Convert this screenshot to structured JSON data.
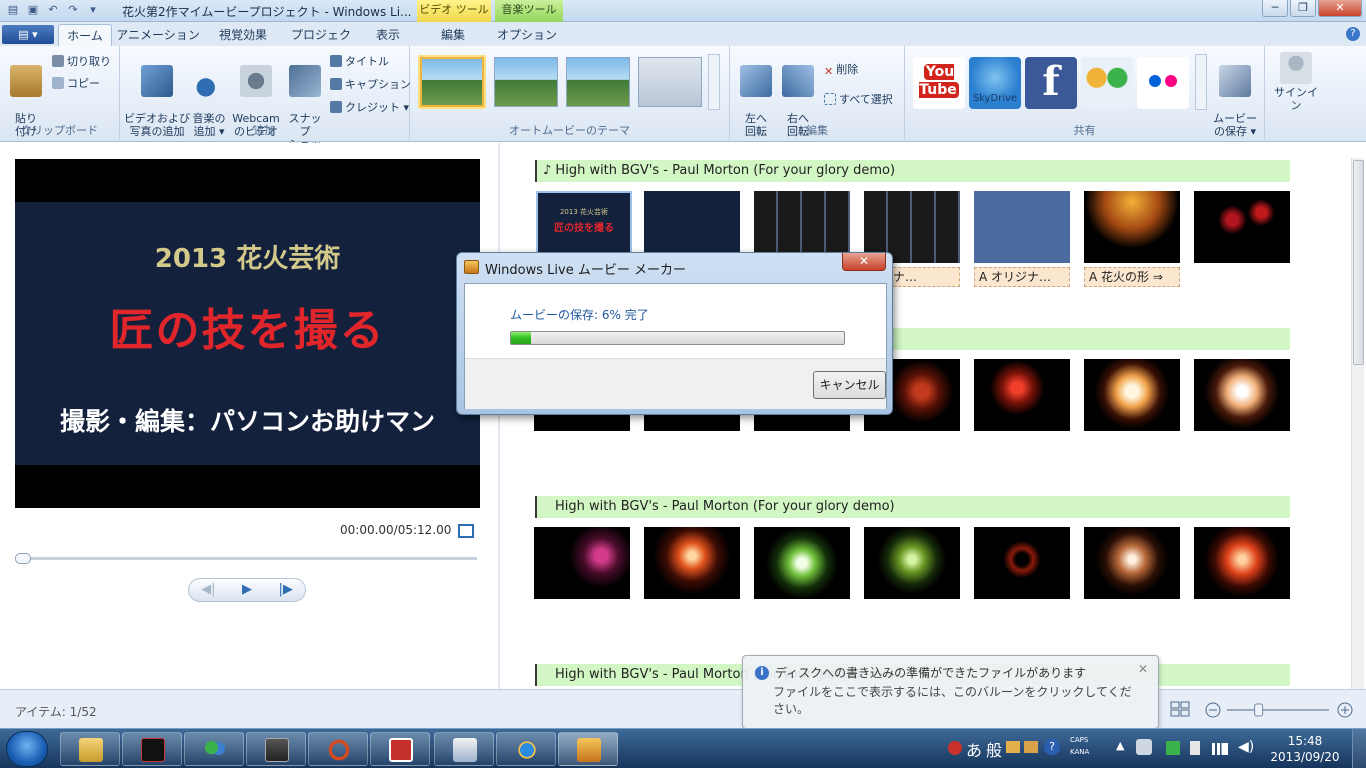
{
  "window": {
    "title": "花火第2作マイムービープロジェクト - Windows Li...",
    "context_tab_video": "ビデオ ツール",
    "context_tab_music": "音楽ツール",
    "minimize": "─",
    "maximize": "❐",
    "close": "✕"
  },
  "tabs": [
    {
      "label": "ホーム",
      "active": true
    },
    {
      "label": "アニメーション"
    },
    {
      "label": "視覚効果"
    },
    {
      "label": "プロジェクト"
    },
    {
      "label": "表示"
    },
    {
      "label": "編集"
    },
    {
      "label": "オプション"
    }
  ],
  "ribbon": {
    "clipboard": {
      "paste": "貼り\n付け",
      "cut": "切り取り",
      "copy": "コピー",
      "group": "クリップボード"
    },
    "add": {
      "video_photo": "ビデオおよび\n写真の追加",
      "music": "音楽の\n追加 ▾",
      "webcam": "Webcam\nのビデオ",
      "snapshot": "スナップ\nショット",
      "title": "タイトル",
      "caption": "キャプション",
      "credit": "クレジット ▾",
      "group": "追加"
    },
    "themes": {
      "group": "オートムービーのテーマ"
    },
    "edit": {
      "rotate_left": "左へ\n回転",
      "rotate_right": "右へ\n回転",
      "delete": "削除",
      "select_all": "すべて選択",
      "group": "編集"
    },
    "share": {
      "youtube": "You\nTube",
      "skydrive": "SkyDrive",
      "facebook": "f",
      "save_movie": "ムービー\nの保存 ▾",
      "signin": "サインイン",
      "group": "共有"
    }
  },
  "preview": {
    "line1": "2013 花火芸術",
    "line2": "匠の技を撮る",
    "line3": "撮影・編集：パソコンお助けマン",
    "timecode": "00:00.00/05:12.00",
    "prev": "◀|",
    "play": "▶",
    "next": "|▶"
  },
  "storyboard": {
    "music_label": "♪ High with BGV's - Paul Morton (For your glory demo)",
    "music_label_plain": "High with BGV's - Paul Morton (For your glory demo)",
    "captions": [
      "リジナ…",
      "A オリジナ…",
      "A 花火の形 ⇒"
    ]
  },
  "status": {
    "items": "アイテム: 1/52",
    "zoom_level": 0.4
  },
  "dialog": {
    "title": "Windows Live ムービー メーカー",
    "message": "ムービーの保存: 6% 完了",
    "progress": 0.06,
    "cancel": "キャンセル",
    "close": "✕"
  },
  "balloon": {
    "title": "ディスクへの書き込みの準備ができたファイルがあります",
    "text": "ファイルをここで表示するには、このバルーンをクリックしてください。",
    "close": "✕"
  },
  "taskbar": {
    "ime_mode": "あ",
    "ime_kanji": "般",
    "caps": "CAPS",
    "kana": "KANA",
    "time": "15:48",
    "date": "2013/09/20"
  },
  "colors": {
    "accent": "#2f6db3",
    "music_bar": "#d2f7c5",
    "caption_bg": "#fbe7cf",
    "progress": "#2fbf20"
  }
}
